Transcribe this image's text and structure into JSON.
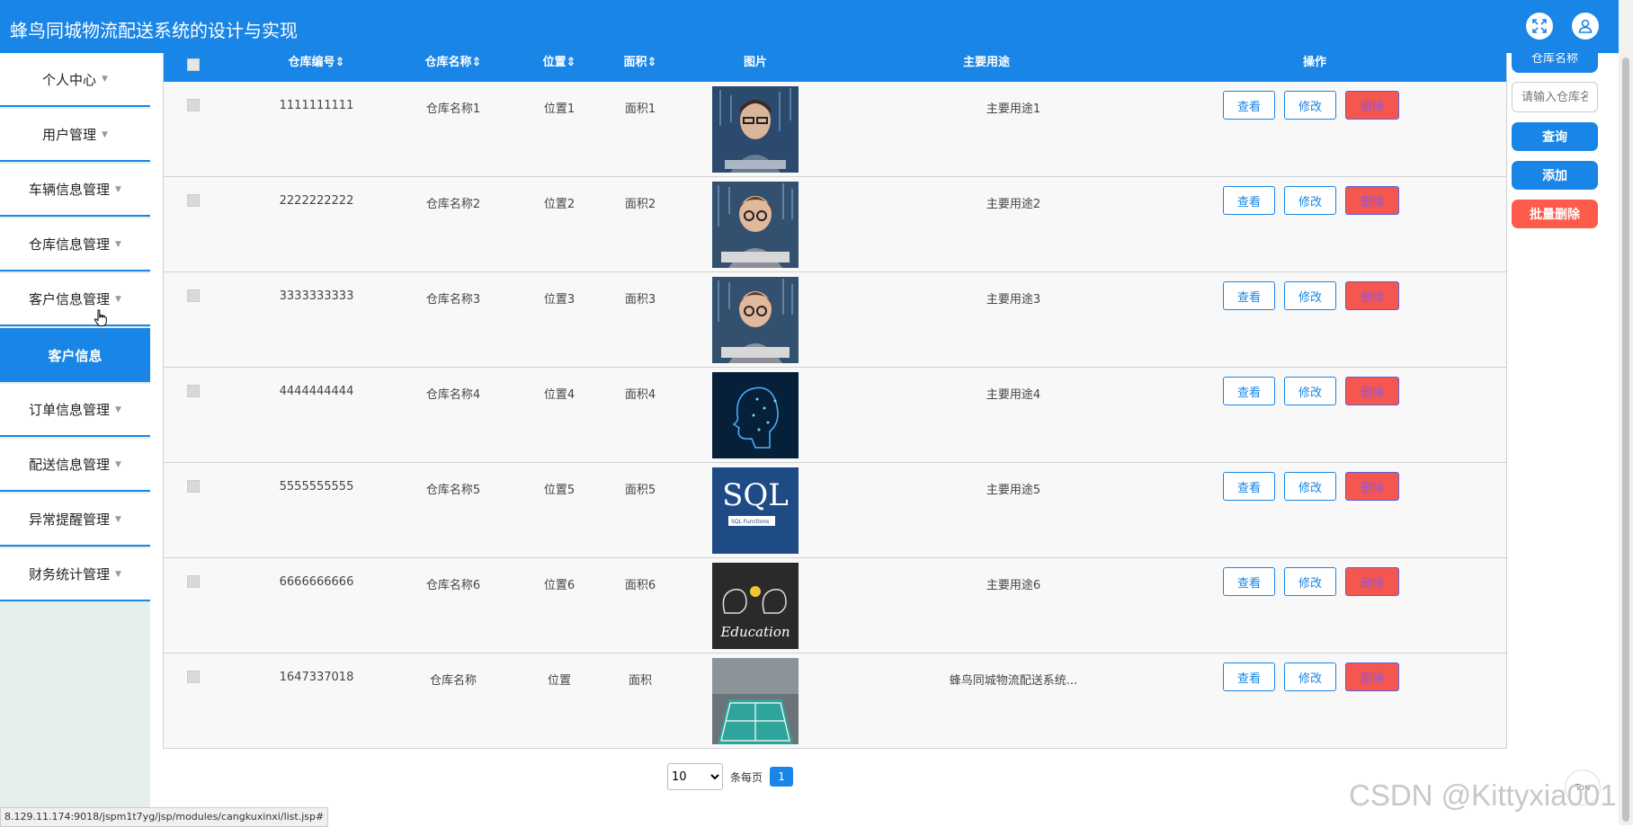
{
  "header": {
    "title": "蜂鸟同城物流配送系统的设计与实现",
    "fullscreen_icon": "expand-icon",
    "user_icon": "user-icon"
  },
  "sidebar": {
    "items": [
      {
        "label": "个人中心",
        "caret": "▼"
      },
      {
        "label": "用户管理",
        "caret": "▼"
      },
      {
        "label": "车辆信息管理",
        "caret": "▼"
      },
      {
        "label": "仓库信息管理",
        "caret": "▼"
      },
      {
        "label": "客户信息管理",
        "caret": "▼"
      },
      {
        "label": "客户信息",
        "active": true
      },
      {
        "label": "订单信息管理",
        "caret": "▼"
      },
      {
        "label": "配送信息管理",
        "caret": "▼"
      },
      {
        "label": "异常提醒管理",
        "caret": "▼"
      },
      {
        "label": "财务统计管理",
        "caret": "▼"
      }
    ]
  },
  "table": {
    "headers": {
      "code": "仓库编号",
      "name": "仓库名称",
      "location": "位置",
      "area": "面积",
      "image": "图片",
      "usage": "主要用途",
      "actions": "操作",
      "sort_icon": "⇕"
    },
    "rows": [
      {
        "code": "1111111111",
        "name": "仓库名称1",
        "location": "位置1",
        "area": "面积1",
        "usage": "主要用途1",
        "image": "man-at-keyboard"
      },
      {
        "code": "2222222222",
        "name": "仓库名称2",
        "location": "位置2",
        "area": "面积2",
        "usage": "主要用途2",
        "image": "child-at-keyboard"
      },
      {
        "code": "3333333333",
        "name": "仓库名称3",
        "location": "位置3",
        "area": "面积3",
        "usage": "主要用途3",
        "image": "child-at-keyboard"
      },
      {
        "code": "4444444444",
        "name": "仓库名称4",
        "location": "位置4",
        "area": "面积4",
        "usage": "主要用途4",
        "image": "digital-head"
      },
      {
        "code": "5555555555",
        "name": "仓库名称5",
        "location": "位置5",
        "area": "面积5",
        "usage": "主要用途5",
        "image": "sql-book",
        "image_text": "SQL",
        "image_subtext": "SQL Functions"
      },
      {
        "code": "6666666666",
        "name": "仓库名称6",
        "location": "位置6",
        "area": "面积6",
        "usage": "主要用途6",
        "image": "education-board",
        "image_text": "Education"
      },
      {
        "code": "1647337018",
        "name": "仓库名称",
        "location": "位置",
        "area": "面积",
        "usage": "蜂鸟同城物流配送系统...",
        "image": "badminton-court"
      }
    ],
    "view_label": "查看",
    "edit_label": "修改",
    "delete_label": "删除"
  },
  "search_panel": {
    "label": "仓库名称",
    "placeholder": "请输入仓库名称",
    "query_label": "查询",
    "add_label": "添加",
    "batch_delete_label": "批量删除"
  },
  "pagination": {
    "page_size": "10",
    "per_page_label": "条每页",
    "current_page": "1"
  },
  "statusbar": {
    "url": "8.129.11.174:9018/jspm1t7yg/jsp/modules/cangkuxinxi/list.jsp#"
  },
  "watermark": "CSDN @Kittyxia001",
  "top_button": "Top",
  "colors": {
    "primary": "#1985e6",
    "danger": "#f5564e",
    "batch_delete": "#ff5b4a",
    "sidebar_bg": "#e4eeeb"
  }
}
